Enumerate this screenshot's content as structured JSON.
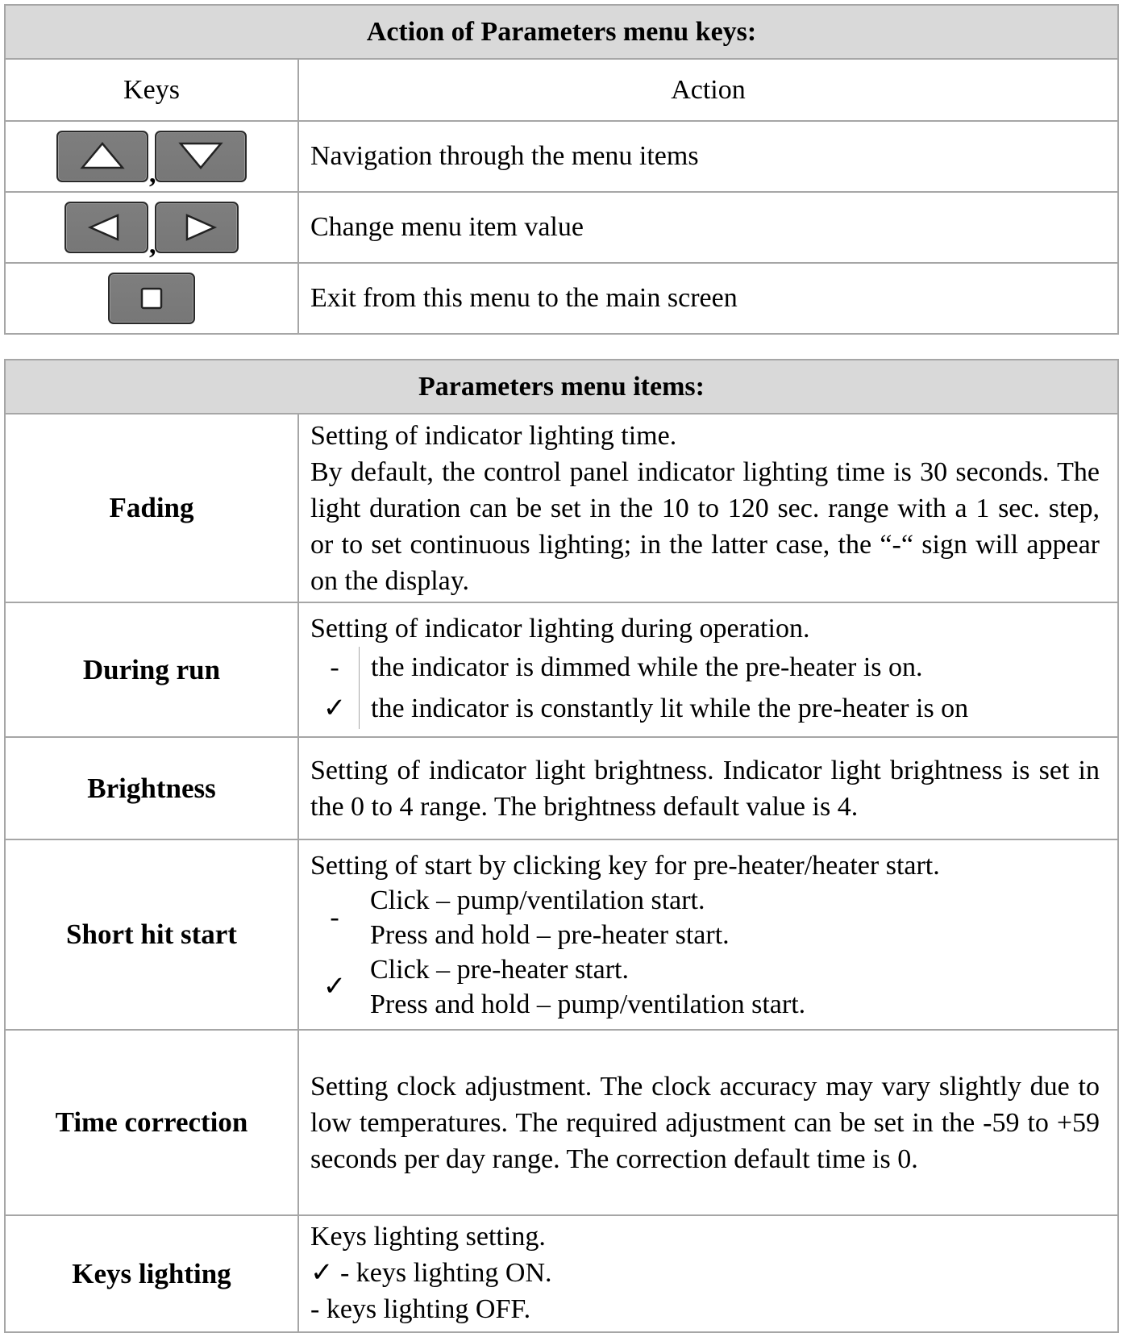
{
  "keys_section": {
    "title": "Action of Parameters menu keys:",
    "col_keys": "Keys",
    "col_action": "Action",
    "rows": [
      {
        "icons": [
          "up-arrow-key-icon",
          "down-arrow-key-icon"
        ],
        "separator": ",",
        "action": "Navigation through the menu items"
      },
      {
        "icons": [
          "left-arrow-key-icon",
          "right-arrow-key-icon"
        ],
        "separator": ",",
        "action": "Change menu item value"
      },
      {
        "icons": [
          "stop-square-key-icon"
        ],
        "action": "Exit from this menu to the main screen"
      }
    ]
  },
  "items_section": {
    "title": "Parameters menu items:",
    "items": [
      {
        "name": "Fading",
        "lines": [
          "Setting of indicator lighting time.",
          "By default, the control panel indicator lighting time is 30 seconds. The light duration can be set in the 10 to 120 sec. range with a 1 sec. step, or to set continuous lighting; in the latter case, the “-“ sign will appear on the display."
        ]
      },
      {
        "name": "During run",
        "intro": "Setting of indicator lighting during operation.",
        "options": [
          {
            "symbol": "-",
            "text": "the indicator is dimmed while the pre-heater is on."
          },
          {
            "symbol": "✓",
            "text": "the indicator is constantly lit while the pre-heater is on"
          }
        ]
      },
      {
        "name": "Brightness",
        "lines": [
          "Setting of indicator light brightness. Indicator light brightness is set in the 0 to 4 range. The brightness default value is 4."
        ]
      },
      {
        "name": "Short hit start",
        "intro": "Setting of start by clicking key for pre-heater/heater start.",
        "options": [
          {
            "symbol": "-",
            "line1": "Click – pump/ventilation start.",
            "line2": "Press and hold – pre-heater start."
          },
          {
            "symbol": "✓",
            "line1": "Click – pre-heater start.",
            "line2": "Press and hold – pump/ventilation start."
          }
        ]
      },
      {
        "name": "Time correction",
        "lines": [
          "Setting clock adjustment. The clock accuracy may vary slightly due to low temperatures. The required adjustment can be set in the -59 to +59 seconds per day range. The correction default time is 0."
        ]
      },
      {
        "name": "Keys lighting",
        "lines": [
          "Keys lighting setting.",
          "✓ - keys lighting ON.",
          "- keys lighting OFF."
        ]
      }
    ]
  }
}
